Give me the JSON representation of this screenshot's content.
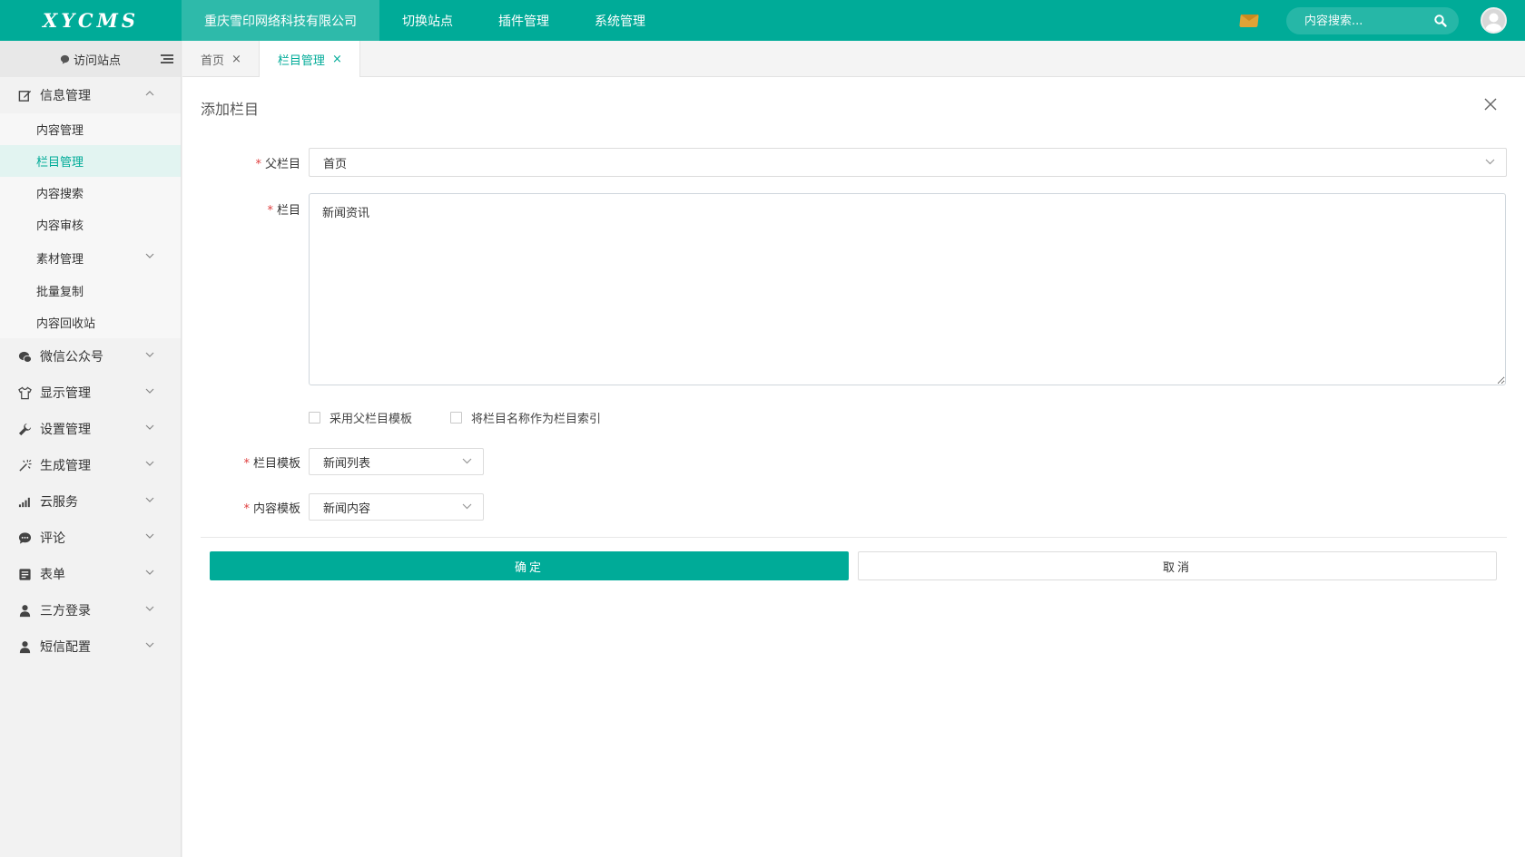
{
  "brand": {
    "logo_text": "XYCMS"
  },
  "topnav": {
    "items": [
      {
        "label": "重庆雪印网络科技有限公司"
      },
      {
        "label": "切换站点"
      },
      {
        "label": "插件管理"
      },
      {
        "label": "系统管理"
      }
    ]
  },
  "search": {
    "placeholder": "内容搜索..."
  },
  "sidebar": {
    "visit_site": "访问站点",
    "groups": [
      {
        "label": "信息管理",
        "items": [
          {
            "label": "内容管理"
          },
          {
            "label": "栏目管理"
          },
          {
            "label": "内容搜索"
          },
          {
            "label": "内容审核"
          },
          {
            "label": "素材管理"
          },
          {
            "label": "批量复制"
          },
          {
            "label": "内容回收站"
          }
        ]
      },
      {
        "label": "微信公众号"
      },
      {
        "label": "显示管理"
      },
      {
        "label": "设置管理"
      },
      {
        "label": "生成管理"
      },
      {
        "label": "云服务"
      },
      {
        "label": "评论"
      },
      {
        "label": "表单"
      },
      {
        "label": "三方登录"
      },
      {
        "label": "短信配置"
      }
    ]
  },
  "tabs": [
    {
      "label": "首页",
      "close": "×"
    },
    {
      "label": "栏目管理",
      "close": "×"
    }
  ],
  "form": {
    "title": "添加栏目",
    "parent": {
      "label": "父栏目",
      "value": "首页"
    },
    "column": {
      "label": "栏目",
      "value": "新闻资讯"
    },
    "options": [
      {
        "label": "采用父栏目模板"
      },
      {
        "label": "将栏目名称作为栏目索引"
      }
    ],
    "column_template": {
      "label": "栏目模板",
      "value": "新闻列表"
    },
    "content_template": {
      "label": "内容模板",
      "value": "新闻内容"
    },
    "required_mark": "*",
    "submit": "确定",
    "cancel": "取消"
  },
  "colors": {
    "primary": "#00ab98",
    "required": "#e04040",
    "mail_icon": "#e0a336"
  }
}
